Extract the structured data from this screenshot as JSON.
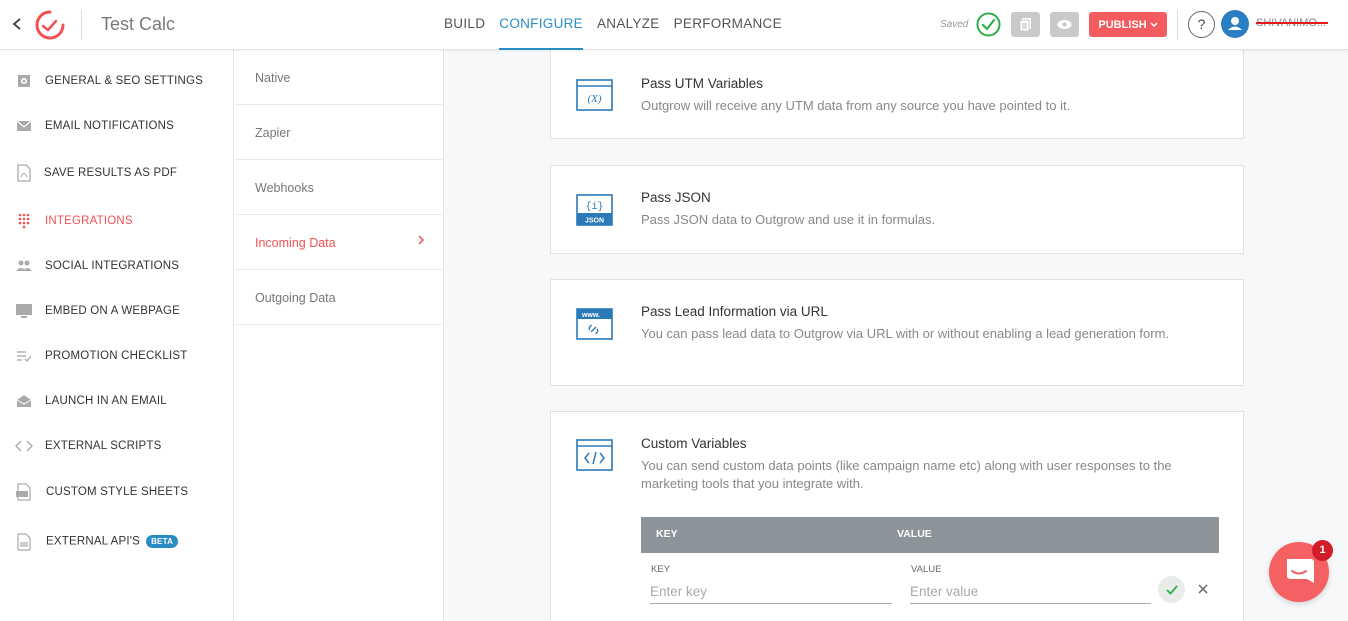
{
  "header": {
    "app_title": "Test Calc",
    "tabs": [
      {
        "label": "BUILD"
      },
      {
        "label": "CONFIGURE"
      },
      {
        "label": "ANALYZE"
      },
      {
        "label": "PERFORMANCE"
      }
    ],
    "active_tab": "CONFIGURE",
    "saved_label": "Saved",
    "publish_label": "PUBLISH",
    "help_label": "?",
    "username": "SHIVANIMO..."
  },
  "sidebar": {
    "items": [
      {
        "label": "GENERAL & SEO SETTINGS",
        "icon": "gear-icon"
      },
      {
        "label": "EMAIL NOTIFICATIONS",
        "icon": "envelope-icon"
      },
      {
        "label": "SAVE RESULTS AS PDF",
        "icon": "pdf-icon"
      },
      {
        "label": "INTEGRATIONS",
        "icon": "grid-dots-icon"
      },
      {
        "label": "SOCIAL INTEGRATIONS",
        "icon": "people-icon"
      },
      {
        "label": "EMBED ON A WEBPAGE",
        "icon": "monitor-icon"
      },
      {
        "label": "PROMOTION CHECKLIST",
        "icon": "checklist-icon"
      },
      {
        "label": "LAUNCH IN AN EMAIL",
        "icon": "open-envelope-icon"
      },
      {
        "label": "EXTERNAL SCRIPTS",
        "icon": "code-icon"
      },
      {
        "label": "CUSTOM STYLE SHEETS",
        "icon": "css-file-icon"
      },
      {
        "label": "EXTERNAL API'S",
        "icon": "api-file-icon",
        "badge": "BETA"
      }
    ],
    "active": "INTEGRATIONS"
  },
  "submenu": {
    "items": [
      {
        "label": "Native"
      },
      {
        "label": "Zapier"
      },
      {
        "label": "Webhooks"
      },
      {
        "label": "Incoming Data"
      },
      {
        "label": "Outgoing Data"
      }
    ],
    "active": "Incoming Data"
  },
  "cards": [
    {
      "title": "Pass UTM Variables",
      "desc": "Outgrow will receive any UTM data from any source you have pointed to it.",
      "icon": "variable-window-icon",
      "icon_text": "(X)"
    },
    {
      "title": "Pass JSON",
      "desc": "Pass JSON data to Outgrow and use it in formulas.",
      "icon": "json-icon",
      "icon_text": "{i}",
      "icon_caption": "JSON"
    },
    {
      "title": "Pass Lead Information via URL",
      "desc": "You can pass lead data to Outgrow via URL with or without enabling a lead generation form.",
      "icon": "www-link-icon",
      "icon_text": "www."
    },
    {
      "title": "Custom Variables",
      "desc": "You can send custom data points (like campaign name etc) along with user responses to the marketing tools that you integrate with.",
      "icon": "code-window-icon"
    }
  ],
  "custom_variables": {
    "key_header": "KEY",
    "value_header": "VALUE",
    "key_label": "KEY",
    "value_label": "VALUE",
    "key_placeholder": "Enter key",
    "value_placeholder": "Enter value"
  },
  "chat": {
    "badge_count": "1"
  },
  "colors": {
    "accent_blue": "#2a8cc4",
    "accent_red": "#f05252",
    "publish_red": "#f35b5e",
    "saved_green": "#2fae4a"
  }
}
